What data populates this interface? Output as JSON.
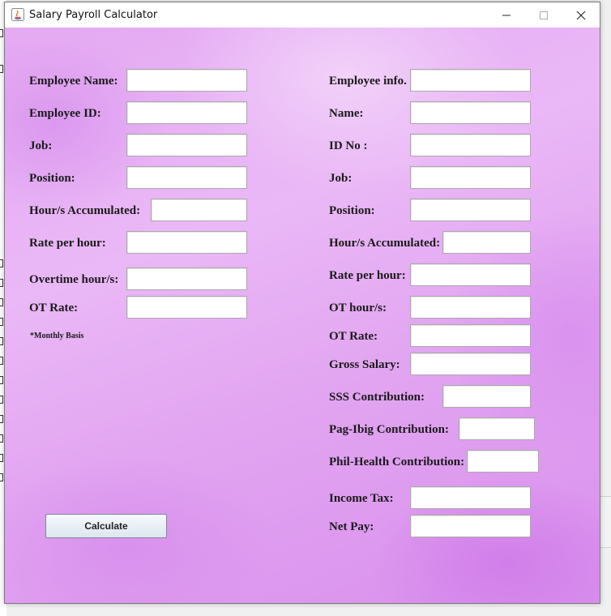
{
  "window": {
    "title": "Salary Payroll Calculator",
    "controls": {
      "minimize": "—",
      "maximize": "☐",
      "close": "✕"
    }
  },
  "left_form": {
    "employee_name": "Employee Name:",
    "employee_id": "Employee ID:",
    "job": "Job:",
    "position": "Position:",
    "hours_accumulated": "Hour/s Accumulated:",
    "rate_per_hour": "Rate per hour:",
    "overtime_hours": "Overtime hour/s:",
    "ot_rate": "OT Rate:",
    "note": "*Monthly Basis"
  },
  "right_form": {
    "employee_info": "Employee info.",
    "name": "Name:",
    "id_no": "ID No :",
    "job": "Job:",
    "position": "Position:",
    "hours_accumulated": "Hour/s Accumulated:",
    "rate_per_hour": "Rate per hour:",
    "ot_hours": "OT hour/s:",
    "ot_rate": "OT Rate:",
    "gross_salary": "Gross Salary:",
    "sss": "SSS Contribution:",
    "pagibig": "Pag-Ibig Contribution:",
    "philhealth": "Phil-Health Contribution:",
    "income_tax": "Income Tax:",
    "net_pay": "Net Pay:"
  },
  "buttons": {
    "calculate": "Calculate"
  }
}
